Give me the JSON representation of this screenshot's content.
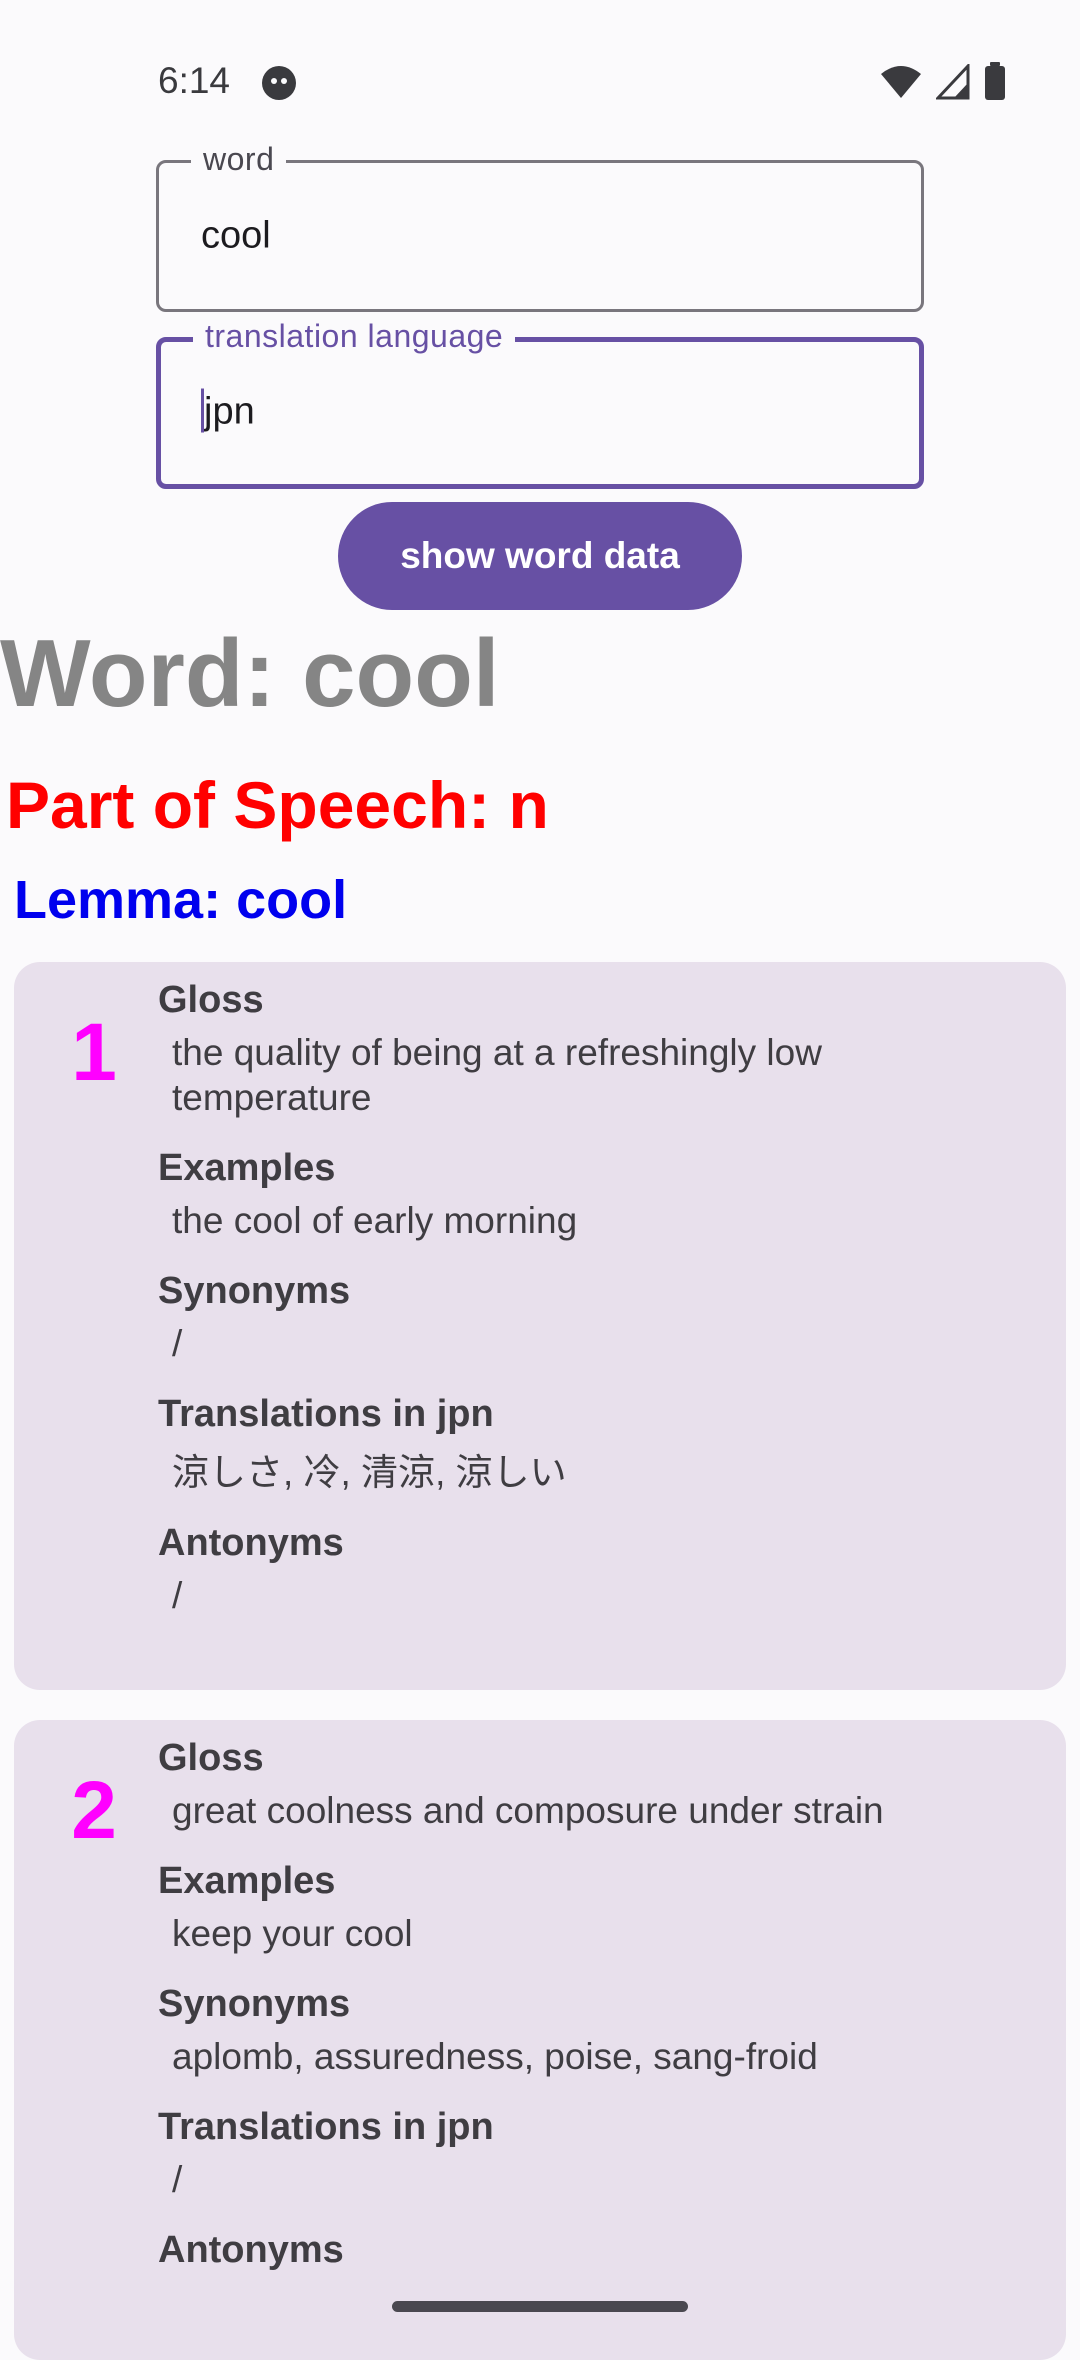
{
  "status_bar": {
    "time": "6:14",
    "app_icon": "face-icon",
    "icons": [
      "wifi-icon",
      "signal-icon",
      "battery-icon"
    ]
  },
  "form": {
    "word_label": "word",
    "word_value": "cool",
    "lang_label": "translation language",
    "lang_value": "jpn",
    "show_button": "show word data"
  },
  "result": {
    "word_heading": "Word: cool",
    "pos_heading": "Part of Speech: n",
    "lemma_heading": "Lemma: cool",
    "senses": [
      {
        "number": "1",
        "gloss_heading": "Gloss",
        "gloss": "the quality of being at a refreshingly low temperature",
        "examples_heading": "Examples",
        "examples": "the cool of early morning",
        "synonyms_heading": "Synonyms",
        "synonyms": "/",
        "translations_heading": "Translations in jpn",
        "translations": "涼しさ, 冷, 清涼, 涼しい",
        "antonyms_heading": "Antonyms",
        "antonyms": "/"
      },
      {
        "number": "2",
        "gloss_heading": "Gloss",
        "gloss": "great coolness and composure under strain",
        "examples_heading": "Examples",
        "examples": "keep your cool",
        "synonyms_heading": "Synonyms",
        "synonyms": "aplomb, assuredness, poise, sang-froid",
        "translations_heading": "Translations in jpn",
        "translations": "/",
        "antonyms_heading": "Antonyms"
      }
    ]
  },
  "colors": {
    "accent": "#6750A4",
    "word_heading": "#858585",
    "pos_heading": "#FF0000",
    "lemma_heading": "#0000EE",
    "sense_number": "#FF00FF",
    "card_background": "#E8E0EC"
  }
}
